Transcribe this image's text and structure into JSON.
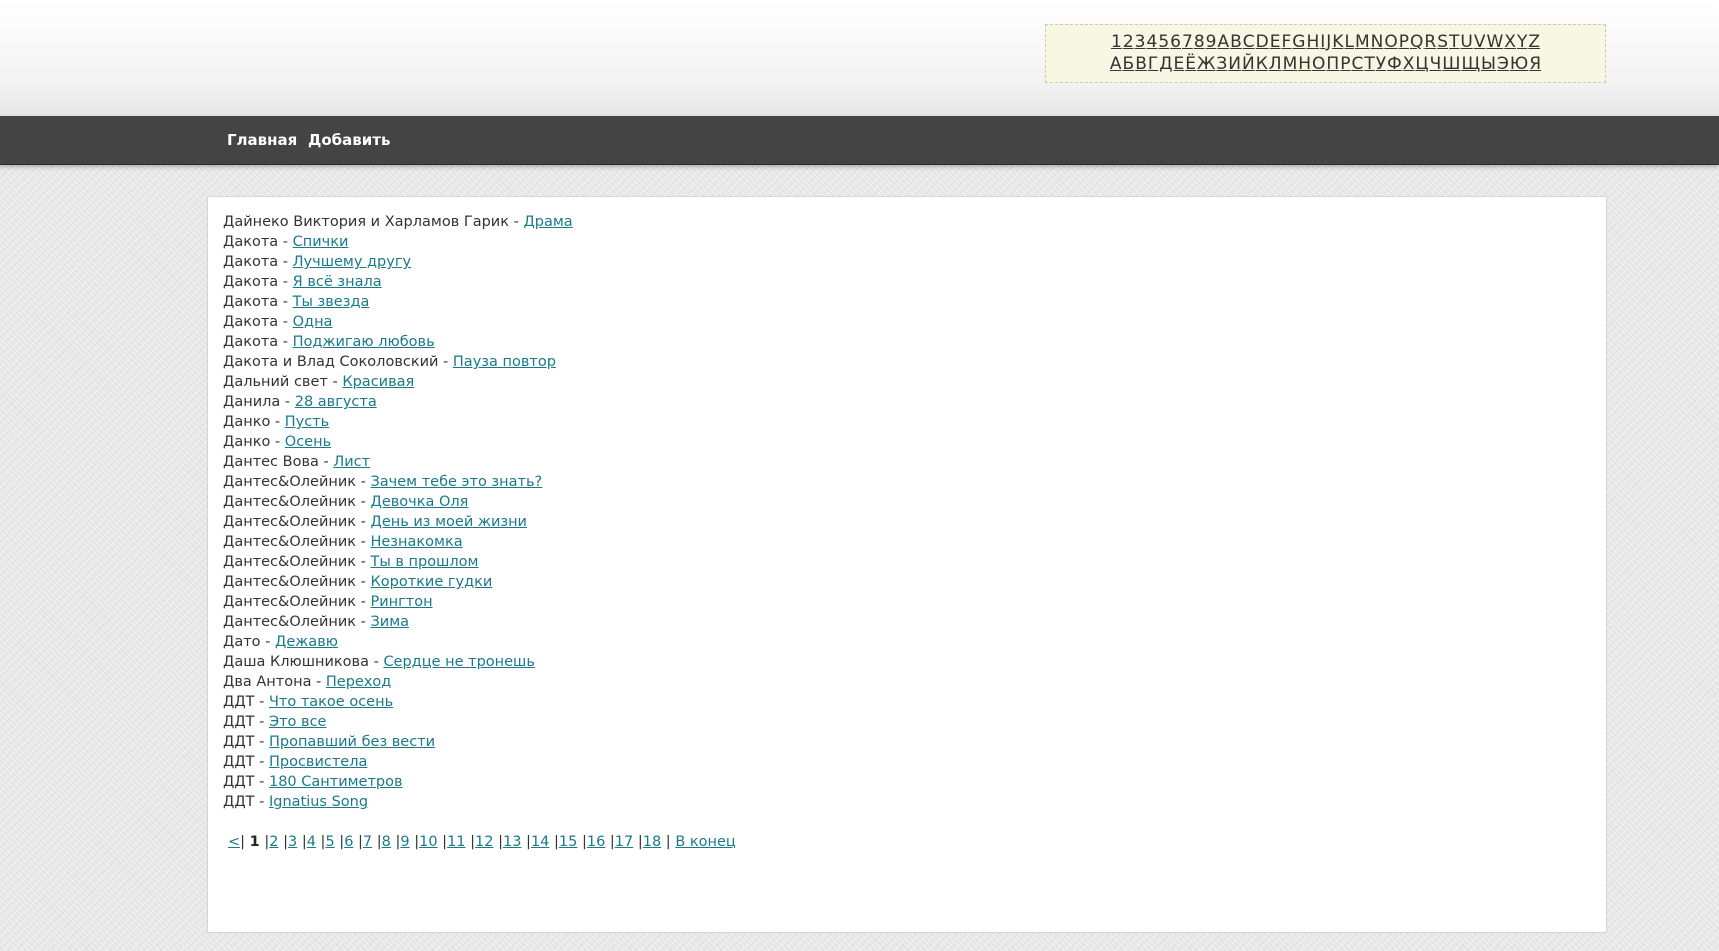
{
  "alphabet": {
    "latin": [
      "1",
      "2",
      "3",
      "4",
      "5",
      "6",
      "7",
      "8",
      "9",
      "A",
      "B",
      "C",
      "D",
      "E",
      "F",
      "G",
      "H",
      "I",
      "J",
      "K",
      "L",
      "M",
      "N",
      "O",
      "P",
      "Q",
      "R",
      "S",
      "T",
      "U",
      "V",
      "W",
      "X",
      "Y",
      "Z"
    ],
    "cyrillic": [
      "А",
      "Б",
      "В",
      "Г",
      "Д",
      "Е",
      "Ё",
      "Ж",
      "З",
      "И",
      "Й",
      "К",
      "Л",
      "М",
      "Н",
      "О",
      "П",
      "Р",
      "С",
      "Т",
      "У",
      "Ф",
      "Х",
      "Ц",
      "Ч",
      "Ш",
      "Щ",
      "Ы",
      "Э",
      "Ю",
      "Я"
    ]
  },
  "nav": {
    "home": "Главная",
    "add": "Добавить"
  },
  "songs": [
    {
      "artist": "Дайнеко Виктория и Харламов Гарик",
      "title": "Драма"
    },
    {
      "artist": "Дакота",
      "title": "Спички"
    },
    {
      "artist": "Дакота",
      "title": "Лучшему другу"
    },
    {
      "artist": "Дакота",
      "title": "Я всё знала"
    },
    {
      "artist": "Дакота",
      "title": "Ты звезда"
    },
    {
      "artist": "Дакота",
      "title": "Одна"
    },
    {
      "artist": "Дакота",
      "title": "Поджигаю любовь"
    },
    {
      "artist": "Дакота и Влад Соколовский",
      "title": "Пауза повтор"
    },
    {
      "artist": "Дальний свет",
      "title": "Красивая"
    },
    {
      "artist": "Данила",
      "title": "28 августа"
    },
    {
      "artist": "Данко",
      "title": "Пусть"
    },
    {
      "artist": "Данко",
      "title": "Осень"
    },
    {
      "artist": "Дантес Вова",
      "title": "Лист"
    },
    {
      "artist": "Дантес&Олейник",
      "title": "Зачем тебе это знать?"
    },
    {
      "artist": "Дантес&Олейник",
      "title": "Девочка Оля"
    },
    {
      "artist": "Дантес&Олейник",
      "title": "День из моей жизни"
    },
    {
      "artist": "Дантес&Олейник",
      "title": "Незнакомка"
    },
    {
      "artist": "Дантес&Олейник",
      "title": "Ты в прошлом"
    },
    {
      "artist": "Дантес&Олейник",
      "title": "Короткие гудки"
    },
    {
      "artist": "Дантес&Олейник",
      "title": "Рингтон"
    },
    {
      "artist": "Дантес&Олейник",
      "title": "Зима"
    },
    {
      "artist": "Дато",
      "title": "Дежавю"
    },
    {
      "artist": "Даша Клюшникова",
      "title": "Сердце не тронешь"
    },
    {
      "artist": "Два Антона",
      "title": "Переход"
    },
    {
      "artist": "ДДТ",
      "title": "Что такое осень"
    },
    {
      "artist": "ДДТ",
      "title": "Это все"
    },
    {
      "artist": "ДДТ",
      "title": "Пропавший без вести"
    },
    {
      "artist": "ДДТ",
      "title": "Просвистела"
    },
    {
      "artist": "ДДТ",
      "title": "180 Сантиметров"
    },
    {
      "artist": "ДДТ",
      "title": "Ignatius Song"
    }
  ],
  "separator": " - ",
  "pagination": {
    "prev": "<",
    "current": "1",
    "pages": [
      "2",
      "3",
      "4",
      "5",
      "6",
      "7",
      "8",
      "9",
      "10",
      "11",
      "12",
      "13",
      "14",
      "15",
      "16",
      "17",
      "18"
    ],
    "last": "В конец",
    "divider": "|"
  }
}
